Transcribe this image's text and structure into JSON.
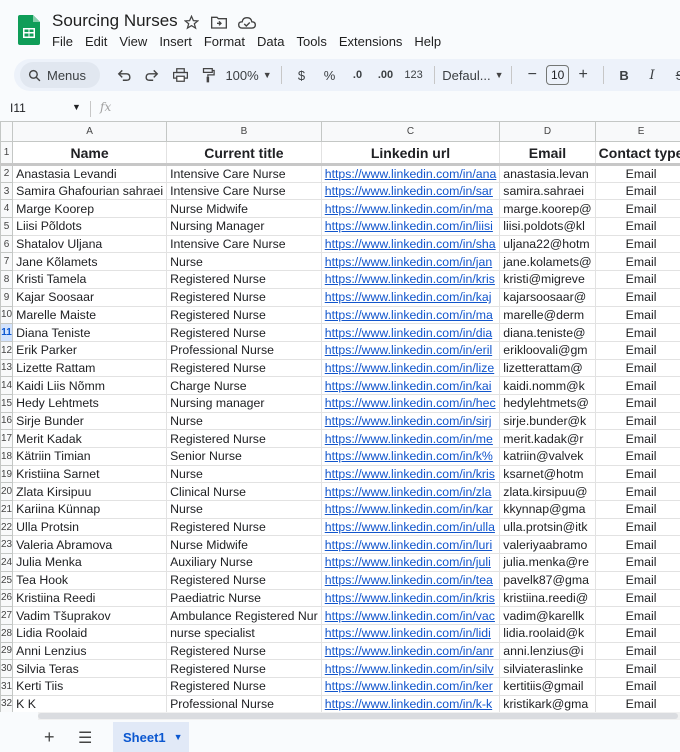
{
  "doc": {
    "title": "Sourcing Nurses"
  },
  "menu": [
    "File",
    "Edit",
    "View",
    "Insert",
    "Format",
    "Data",
    "Tools",
    "Extensions",
    "Help"
  ],
  "toolbar": {
    "search_label": "Menus",
    "zoom": "100%",
    "currency": "$",
    "percent": "%",
    "dec_decrease": ".0",
    "dec_increase": ".00",
    "number_format": "123",
    "font": "Defaul...",
    "minus": "−",
    "font_size": "10",
    "plus": "+",
    "bold": "B",
    "italic": "I",
    "strike": "S"
  },
  "formula_bar": {
    "name_box": "I11",
    "fx": "fx"
  },
  "columns": [
    "A",
    "B",
    "C",
    "D",
    "E"
  ],
  "header_row": {
    "row": "1",
    "cells": [
      "Name",
      "Current title",
      "Linkedin url",
      "Email",
      "Contact type"
    ]
  },
  "selected_row": "11",
  "rows": [
    {
      "n": "2",
      "name": "Anastasia Levandi",
      "title": "Intensive Care Nurse",
      "url": "https://www.linkedin.com/in/ana",
      "email": "anastasia.levan",
      "type": "Email"
    },
    {
      "n": "3",
      "name": "Samira Ghafourian sahraei",
      "title": "Intensive Care Nurse",
      "url": "https://www.linkedin.com/in/sar",
      "email": "samira.sahraei",
      "type": "Email"
    },
    {
      "n": "4",
      "name": "Marge Koorep",
      "title": "Nurse Midwife",
      "url": "https://www.linkedin.com/in/ma",
      "email": "marge.koorep@",
      "type": "Email"
    },
    {
      "n": "5",
      "name": "Liisi Põldots",
      "title": "Nursing Manager",
      "url": "https://www.linkedin.com/in/liisi",
      "email": "liisi.poldots@kl",
      "type": "Email"
    },
    {
      "n": "6",
      "name": "Shatalov Uljana",
      "title": "Intensive Care Nurse",
      "url": "https://www.linkedin.com/in/sha",
      "email": "uljana22@hotm",
      "type": "Email"
    },
    {
      "n": "7",
      "name": "Jane Kõlamets",
      "title": "Nurse",
      "url": "https://www.linkedin.com/in/jan",
      "email": "jane.kolamets@",
      "type": "Email"
    },
    {
      "n": "8",
      "name": "Kristi Tamela",
      "title": "Registered Nurse",
      "url": "https://www.linkedin.com/in/kris",
      "email": "kristi@migreve",
      "type": "Email"
    },
    {
      "n": "9",
      "name": "Kajar Soosaar",
      "title": "Registered Nurse",
      "url": "https://www.linkedin.com/in/kaj",
      "email": "kajarsoosaar@",
      "type": "Email"
    },
    {
      "n": "10",
      "name": "Marelle Maiste",
      "title": "Registered Nurse",
      "url": "https://www.linkedin.com/in/ma",
      "email": "marelle@derm",
      "type": "Email"
    },
    {
      "n": "11",
      "name": "Diana Teniste",
      "title": "Registered Nurse",
      "url": "https://www.linkedin.com/in/dia",
      "email": "diana.teniste@",
      "type": "Email"
    },
    {
      "n": "12",
      "name": "Erik Parker",
      "title": "Professional Nurse",
      "url": "https://www.linkedin.com/in/eril",
      "email": "erikloovali@gm",
      "type": "Email"
    },
    {
      "n": "13",
      "name": "Lizette Rattam",
      "title": "Registered Nurse",
      "url": "https://www.linkedin.com/in/lize",
      "email": "lizetterattam@",
      "type": "Email"
    },
    {
      "n": "14",
      "name": "Kaidi Liis Nõmm",
      "title": "Charge Nurse",
      "url": "https://www.linkedin.com/in/kai",
      "email": "kaidi.nomm@k",
      "type": "Email"
    },
    {
      "n": "15",
      "name": "Hedy Lehtmets",
      "title": "Nursing manager",
      "url": "https://www.linkedin.com/in/hec",
      "email": "hedylehtmets@",
      "type": "Email"
    },
    {
      "n": "16",
      "name": "Sirje Bunder",
      "title": "Nurse",
      "url": "https://www.linkedin.com/in/sirj",
      "email": "sirje.bunder@k",
      "type": "Email"
    },
    {
      "n": "17",
      "name": "Merit Kadak",
      "title": "Registered Nurse",
      "url": "https://www.linkedin.com/in/me",
      "email": "merit.kadak@r",
      "type": "Email"
    },
    {
      "n": "18",
      "name": "Kätriin Timian",
      "title": "Senior Nurse",
      "url": "https://www.linkedin.com/in/k%",
      "email": "katriin@valvek",
      "type": "Email"
    },
    {
      "n": "19",
      "name": "Kristiina Sarnet",
      "title": "Nurse",
      "url": "https://www.linkedin.com/in/kris",
      "email": "ksarnet@hotm",
      "type": "Email"
    },
    {
      "n": "20",
      "name": "Zlata Kirsipuu",
      "title": "Clinical Nurse",
      "url": "https://www.linkedin.com/in/zla",
      "email": "zlata.kirsipuu@",
      "type": "Email"
    },
    {
      "n": "21",
      "name": "Kariina Künnap",
      "title": "Nurse",
      "url": "https://www.linkedin.com/in/kar",
      "email": "kkynnap@gma",
      "type": "Email"
    },
    {
      "n": "22",
      "name": "Ulla Protsin",
      "title": "Registered Nurse",
      "url": "https://www.linkedin.com/in/ulla",
      "email": "ulla.protsin@itk",
      "type": "Email"
    },
    {
      "n": "23",
      "name": "Valeria Abramova",
      "title": "Nurse Midwife",
      "url": "https://www.linkedin.com/in/luri",
      "email": "valeriyaabramo",
      "type": "Email"
    },
    {
      "n": "24",
      "name": "Julia Menka",
      "title": "Auxiliary Nurse",
      "url": "https://www.linkedin.com/in/juli",
      "email": "julia.menka@re",
      "type": "Email"
    },
    {
      "n": "25",
      "name": "Tea Hook",
      "title": "Registered Nurse",
      "url": "https://www.linkedin.com/in/tea",
      "email": "pavelk87@gma",
      "type": "Email"
    },
    {
      "n": "26",
      "name": "Kristiina Reedi",
      "title": "Paediatric Nurse",
      "url": "https://www.linkedin.com/in/kris",
      "email": "kristiina.reedi@",
      "type": "Email"
    },
    {
      "n": "27",
      "name": "Vadim Tšuprakov",
      "title": "Ambulance Registered Nur",
      "url": "https://www.linkedin.com/in/vac",
      "email": "vadim@karellk",
      "type": "Email"
    },
    {
      "n": "28",
      "name": "Lidia Roolaid",
      "title": "nurse specialist",
      "url": "https://www.linkedin.com/in/lidi",
      "email": "lidia.roolaid@k",
      "type": "Email"
    },
    {
      "n": "29",
      "name": "Anni Lenzius",
      "title": "Registered Nurse",
      "url": "https://www.linkedin.com/in/anr",
      "email": "anni.lenzius@i",
      "type": "Email"
    },
    {
      "n": "30",
      "name": "Silvia Teras",
      "title": "Registered Nurse",
      "url": "https://www.linkedin.com/in/silv",
      "email": "silviateraslinke",
      "type": "Email"
    },
    {
      "n": "31",
      "name": "Kerti Tiis",
      "title": "Registered Nurse",
      "url": "https://www.linkedin.com/in/ker",
      "email": "kertitiis@gmail",
      "type": "Email"
    },
    {
      "n": "32",
      "name": "K K",
      "title": "Professional Nurse",
      "url": "https://www.linkedin.com/in/k-k",
      "email": "kristikark@gma",
      "type": "Email"
    }
  ],
  "sheets": [
    {
      "name": "Sheet1"
    }
  ],
  "colors": {
    "link": "#1155cc",
    "selected_row_bg": "#d3e3fd",
    "tab_active": "#0b57d0",
    "logo_green": "#0f9d58"
  }
}
